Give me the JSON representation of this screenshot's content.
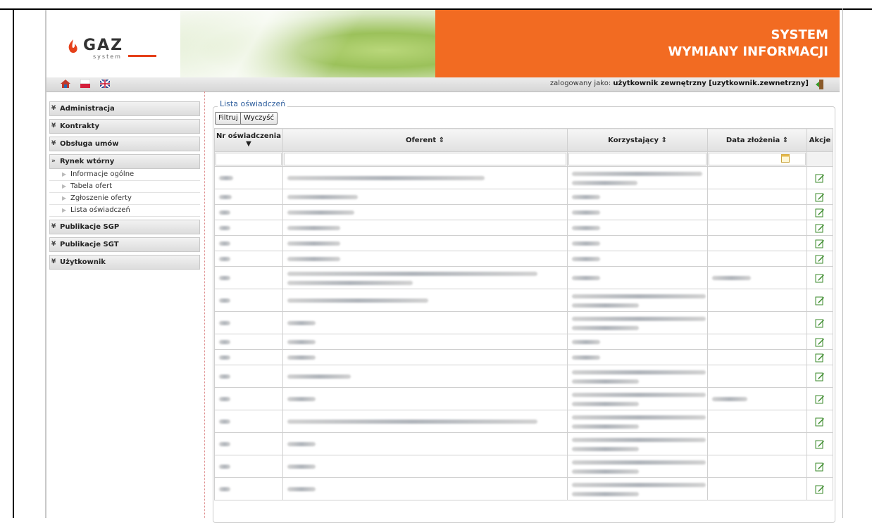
{
  "header": {
    "logo_text": "GAZ",
    "logo_sub": "system",
    "title_line1": "SYSTEM",
    "title_line2": "WYMIANY INFORMACJI"
  },
  "toolbar": {
    "logged_prefix": "zalogowany jako:",
    "logged_user": "użytkownik zewnętrzny [uzytkownik.zewnetrzny]",
    "icons": [
      "home-icon",
      "polish-flag-icon",
      "uk-flag-icon",
      "logout-icon"
    ]
  },
  "sidebar": {
    "items": [
      {
        "label": "Administracja",
        "arrow": "¥"
      },
      {
        "label": "Kontrakty",
        "arrow": "¥"
      },
      {
        "label": "Obsługa umów",
        "arrow": "¥"
      },
      {
        "label": "Rynek wtórny",
        "arrow": "»"
      },
      {
        "label": "Publikacje SGP",
        "arrow": "¥"
      },
      {
        "label": "Publikacje SGT",
        "arrow": "¥"
      },
      {
        "label": "Użytkownik",
        "arrow": "¥"
      }
    ],
    "submenu": [
      "Informacje ogólne",
      "Tabela ofert",
      "Zgłoszenie oferty",
      "Lista oświadczeń"
    ]
  },
  "main": {
    "legend": "Lista oświadczeń",
    "filter_button": "Filtruj",
    "clear_button": "Wyczyść",
    "columns": [
      "Nr oświadczenia",
      "Oferent ⇕",
      "Korzystający ⇕",
      "Data złożenia ⇕",
      "Akcje"
    ],
    "rows": [
      {
        "h": 32,
        "b": [
          20,
          280,
          185,
          0
        ],
        "two": [
          false,
          false,
          true,
          false
        ]
      },
      {
        "h": 22,
        "b": [
          18,
          100,
          40,
          0
        ],
        "two": [
          false,
          false,
          false,
          false
        ]
      },
      {
        "h": 22,
        "b": [
          16,
          95,
          40,
          0
        ],
        "two": [
          false,
          false,
          false,
          false
        ]
      },
      {
        "h": 22,
        "b": [
          16,
          75,
          40,
          0
        ],
        "two": [
          false,
          false,
          false,
          false
        ]
      },
      {
        "h": 22,
        "b": [
          16,
          75,
          40,
          0
        ],
        "two": [
          false,
          false,
          false,
          false
        ]
      },
      {
        "h": 22,
        "b": [
          16,
          75,
          40,
          0
        ],
        "two": [
          false,
          false,
          false,
          false
        ]
      },
      {
        "h": 32,
        "b": [
          16,
          355,
          40,
          55
        ],
        "two": [
          false,
          true,
          false,
          false
        ]
      },
      {
        "h": 32,
        "b": [
          16,
          200,
          190,
          0
        ],
        "two": [
          false,
          false,
          true,
          false
        ]
      },
      {
        "h": 32,
        "b": [
          16,
          40,
          190,
          0
        ],
        "two": [
          false,
          false,
          true,
          false
        ]
      },
      {
        "h": 22,
        "b": [
          16,
          40,
          40,
          0
        ],
        "two": [
          false,
          false,
          false,
          false
        ]
      },
      {
        "h": 22,
        "b": [
          16,
          40,
          40,
          0
        ],
        "two": [
          false,
          false,
          false,
          false
        ]
      },
      {
        "h": 32,
        "b": [
          16,
          90,
          190,
          0
        ],
        "two": [
          false,
          false,
          true,
          false
        ]
      },
      {
        "h": 32,
        "b": [
          16,
          40,
          190,
          50
        ],
        "two": [
          false,
          false,
          true,
          false
        ]
      },
      {
        "h": 32,
        "b": [
          16,
          355,
          190,
          0
        ],
        "two": [
          false,
          false,
          true,
          false
        ]
      },
      {
        "h": 32,
        "b": [
          16,
          40,
          190,
          0
        ],
        "two": [
          false,
          false,
          true,
          false
        ]
      },
      {
        "h": 32,
        "b": [
          16,
          40,
          190,
          0
        ],
        "two": [
          false,
          false,
          true,
          false
        ]
      },
      {
        "h": 32,
        "b": [
          16,
          40,
          190,
          0
        ],
        "two": [
          false,
          false,
          true,
          false
        ]
      }
    ]
  },
  "colors": {
    "orange": "#f26b22",
    "link_blue": "#2f5f9e",
    "edit_green": "#3a8a2a"
  }
}
